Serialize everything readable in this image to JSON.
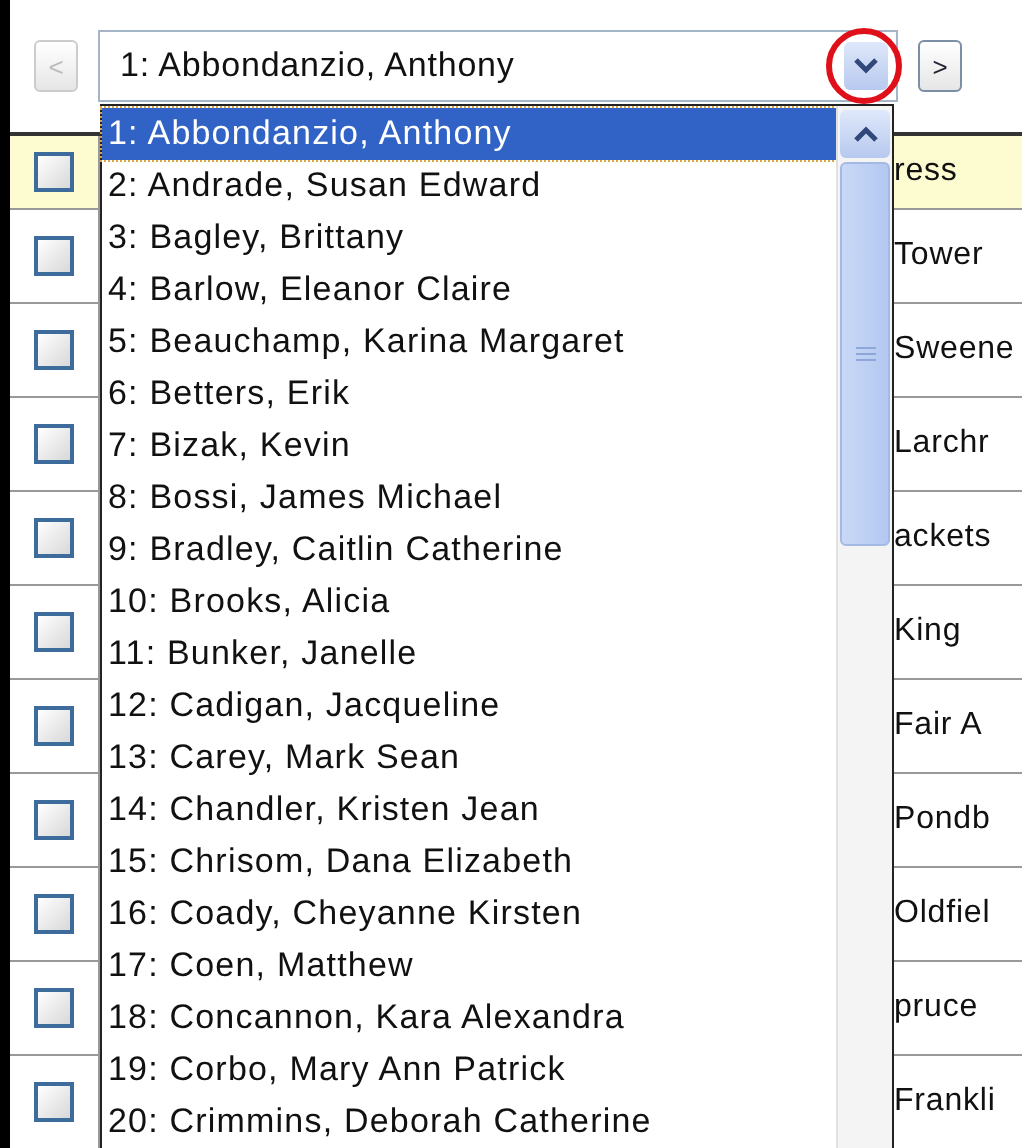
{
  "toolbar": {
    "prev_button": {
      "label": "<",
      "disabled": true
    },
    "selector": {
      "value": "1: Abbondanzio, Anthony"
    },
    "next_button": {
      "label": ">",
      "disabled": false
    }
  },
  "dropdown": {
    "items": [
      {
        "label": "1: Abbondanzio, Anthony",
        "selected": true
      },
      {
        "label": "2: Andrade, Susan Edward",
        "selected": false
      },
      {
        "label": "3: Bagley, Brittany",
        "selected": false
      },
      {
        "label": "4: Barlow, Eleanor Claire",
        "selected": false
      },
      {
        "label": "5: Beauchamp, Karina Margaret",
        "selected": false
      },
      {
        "label": "6: Betters, Erik",
        "selected": false
      },
      {
        "label": "7: Bizak, Kevin",
        "selected": false
      },
      {
        "label": "8: Bossi, James Michael",
        "selected": false
      },
      {
        "label": "9: Bradley, Caitlin Catherine",
        "selected": false
      },
      {
        "label": "10: Brooks, Alicia",
        "selected": false
      },
      {
        "label": "11: Bunker, Janelle",
        "selected": false
      },
      {
        "label": "12: Cadigan, Jacqueline",
        "selected": false
      },
      {
        "label": "13: Carey, Mark Sean",
        "selected": false
      },
      {
        "label": "14: Chandler, Kristen Jean",
        "selected": false
      },
      {
        "label": "15: Chrisom, Dana Elizabeth",
        "selected": false
      },
      {
        "label": "16: Coady, Cheyanne Kirsten",
        "selected": false
      },
      {
        "label": "17: Coen, Matthew",
        "selected": false
      },
      {
        "label": "18: Concannon, Kara Alexandra",
        "selected": false
      },
      {
        "label": "19: Corbo, Mary Ann Patrick",
        "selected": false
      },
      {
        "label": "20: Crimmins, Deborah Catherine",
        "selected": false
      }
    ]
  },
  "table": {
    "header": {
      "checked": false,
      "column_2": "ress"
    },
    "rows": [
      {
        "checked": false,
        "column_2": "Tower"
      },
      {
        "checked": false,
        "column_2": "Sweene"
      },
      {
        "checked": false,
        "column_2": "Larchr"
      },
      {
        "checked": false,
        "column_2": "ackets"
      },
      {
        "checked": false,
        "column_2": "King"
      },
      {
        "checked": false,
        "column_2": "Fair A"
      },
      {
        "checked": false,
        "column_2": "Pondb"
      },
      {
        "checked": false,
        "column_2": "Oldfiel"
      },
      {
        "checked": false,
        "column_2": "pruce"
      },
      {
        "checked": false,
        "column_2": "Frankli"
      }
    ]
  }
}
